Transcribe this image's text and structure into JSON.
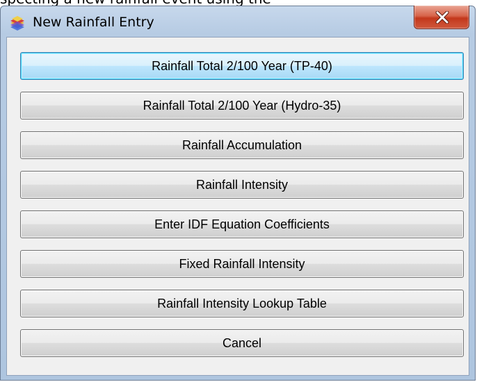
{
  "top_partial_text": "specting a new rainfall event using the",
  "window": {
    "title": "New Rainfall Entry",
    "icon": "rainfall-app-icon",
    "close_icon": "close-icon"
  },
  "buttons": [
    {
      "label": "Rainfall Total 2/100 Year (TP-40)",
      "default": true
    },
    {
      "label": "Rainfall Total 2/100 Year (Hydro-35)"
    },
    {
      "label": "Rainfall Accumulation"
    },
    {
      "label": "Rainfall Intensity"
    },
    {
      "label": "Enter IDF Equation Coefficients"
    },
    {
      "label": "Fixed Rainfall Intensity"
    },
    {
      "label": "Rainfall Intensity Lookup Table"
    },
    {
      "label": "Cancel"
    }
  ],
  "colors": {
    "titlebar": "#b9cde4",
    "close_button": "#c74a32",
    "default_button_border": "#3c7fb1"
  }
}
